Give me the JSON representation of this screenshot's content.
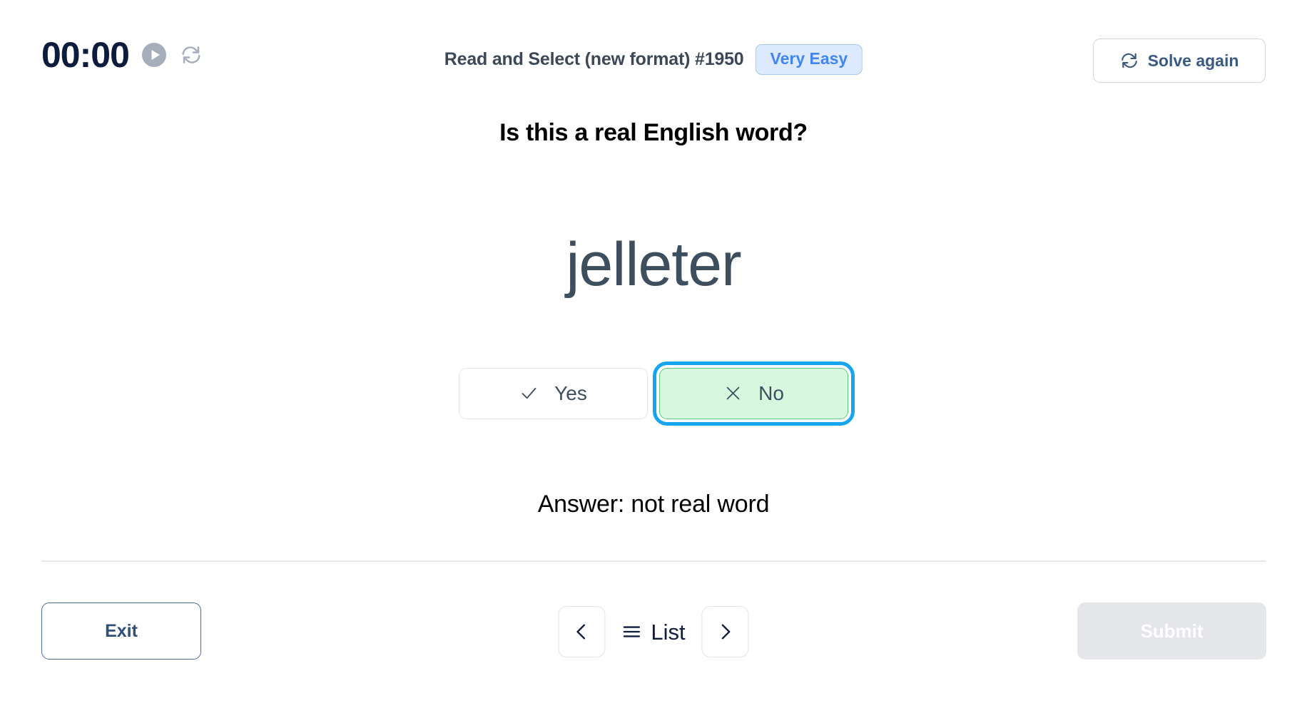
{
  "topbar": {
    "timer": "00:00",
    "play_icon": "play-icon",
    "reset_icon": "reset-icon",
    "exercise_title": "Read and Select (new format) #1950",
    "difficulty_label": "Very Easy",
    "difficulty_color": "#4285f4",
    "difficulty_bg": "#ddeafd",
    "solve_again_label": "Solve again",
    "solve_again_icon": "refresh-icon"
  },
  "main": {
    "question": "Is this a real English word?",
    "word": "jelleter",
    "choices": [
      {
        "label": "Yes",
        "icon": "check-icon",
        "state": "unselected"
      },
      {
        "label": "No",
        "icon": "cross-icon",
        "state": "selected-correct"
      }
    ],
    "answer_text": "Answer: not real word"
  },
  "footer": {
    "exit_label": "Exit",
    "prev_icon": "chevron-left-icon",
    "list_label": "List",
    "list_icon": "hamburger-icon",
    "next_icon": "chevron-right-icon",
    "submit_label": "Submit",
    "submit_disabled": true
  },
  "colors": {
    "accent_blue": "#4285f4",
    "focus_ring": "#16a5f0",
    "correct_green_bg": "#d7f8de",
    "correct_green_border": "#5ec97a",
    "navy": "#0d1c3d",
    "slate": "#3d4f5e",
    "disabled_gray": "#e4e6ea"
  }
}
